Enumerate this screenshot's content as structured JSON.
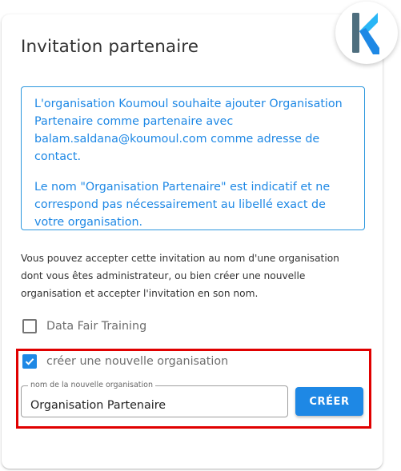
{
  "dialog": {
    "title": "Invitation partenaire"
  },
  "alert": {
    "paragraph1": "L'organisation Koumoul souhaite ajouter Organisation Partenaire comme partenaire avec balam.saldana@koumoul.com comme adresse de contact.",
    "paragraph2": "Le nom \"Organisation Partenaire\" est indicatif et ne correspond pas nécessairement au libellé exact de votre organisation."
  },
  "info_text": "Vous pouvez accepter cette invitation au nom d'une organisation dont vous êtes administrateur, ou bien créer une nouvelle organisation et accepter l'invitation en son nom.",
  "options": {
    "existing_org": {
      "label": "Data Fair Training",
      "checked": false
    },
    "new_org": {
      "label": "créer une nouvelle organisation",
      "checked": true
    }
  },
  "new_org_field": {
    "label": "nom de la nouvelle organisation",
    "value": "Organisation Partenaire"
  },
  "create_button": {
    "label": "CRÉER"
  },
  "colors": {
    "accent": "#1e88e5",
    "highlight": "#e00000"
  },
  "logo": {
    "icon": "koumoul-k-logo"
  }
}
